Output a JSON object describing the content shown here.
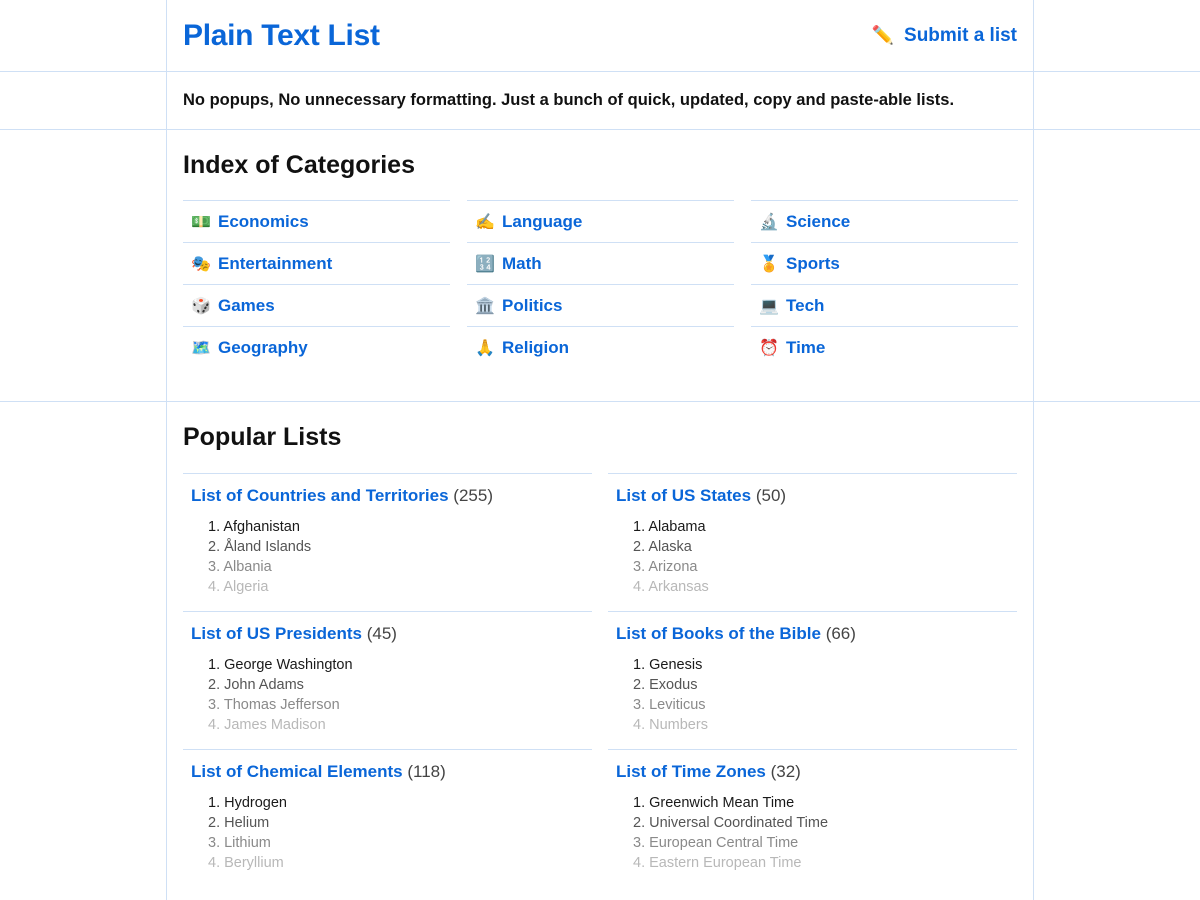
{
  "header": {
    "title": "Plain Text List",
    "submit": {
      "icon": "✏️",
      "label": "Submit a list"
    }
  },
  "tagline": "No popups, No unnecessary formatting. Just a bunch of quick, updated, copy and paste-able lists.",
  "categories": {
    "title": "Index of Categories",
    "items": [
      {
        "icon": "💵",
        "label": "Economics"
      },
      {
        "icon": "✍️",
        "label": "Language"
      },
      {
        "icon": "🔬",
        "label": "Science"
      },
      {
        "icon": "🎭",
        "label": "Entertainment"
      },
      {
        "icon": "🔢",
        "label": "Math"
      },
      {
        "icon": "🏅",
        "label": "Sports"
      },
      {
        "icon": "🎲",
        "label": "Games"
      },
      {
        "icon": "🏛️",
        "label": "Politics"
      },
      {
        "icon": "💻",
        "label": "Tech"
      },
      {
        "icon": "🗺️",
        "label": "Geography"
      },
      {
        "icon": "🙏",
        "label": "Religion"
      },
      {
        "icon": "⏰",
        "label": "Time"
      }
    ]
  },
  "popular": {
    "title": "Popular Lists",
    "lists": [
      {
        "title": "List of Countries and Territories",
        "count": "(255)",
        "items": [
          "1. Afghanistan",
          "2. Åland Islands",
          "3. Albania",
          "4. Algeria"
        ]
      },
      {
        "title": "List of US States",
        "count": "(50)",
        "items": [
          "1. Alabama",
          "2. Alaska",
          "3. Arizona",
          "4. Arkansas"
        ]
      },
      {
        "title": "List of US Presidents",
        "count": "(45)",
        "items": [
          "1. George Washington",
          "2. John Adams",
          "3. Thomas Jefferson",
          "4. James Madison"
        ]
      },
      {
        "title": "List of Books of the Bible",
        "count": "(66)",
        "items": [
          "1. Genesis",
          "2. Exodus",
          "3. Leviticus",
          "4. Numbers"
        ]
      },
      {
        "title": "List of Chemical Elements",
        "count": "(118)",
        "items": [
          "1. Hydrogen",
          "2. Helium",
          "3. Lithium",
          "4. Beryllium"
        ]
      },
      {
        "title": "List of Time Zones",
        "count": "(32)",
        "items": [
          "1. Greenwich Mean Time",
          "2. Universal Coordinated Time",
          "3. European Central Time",
          "4. Eastern European Time"
        ]
      }
    ]
  }
}
